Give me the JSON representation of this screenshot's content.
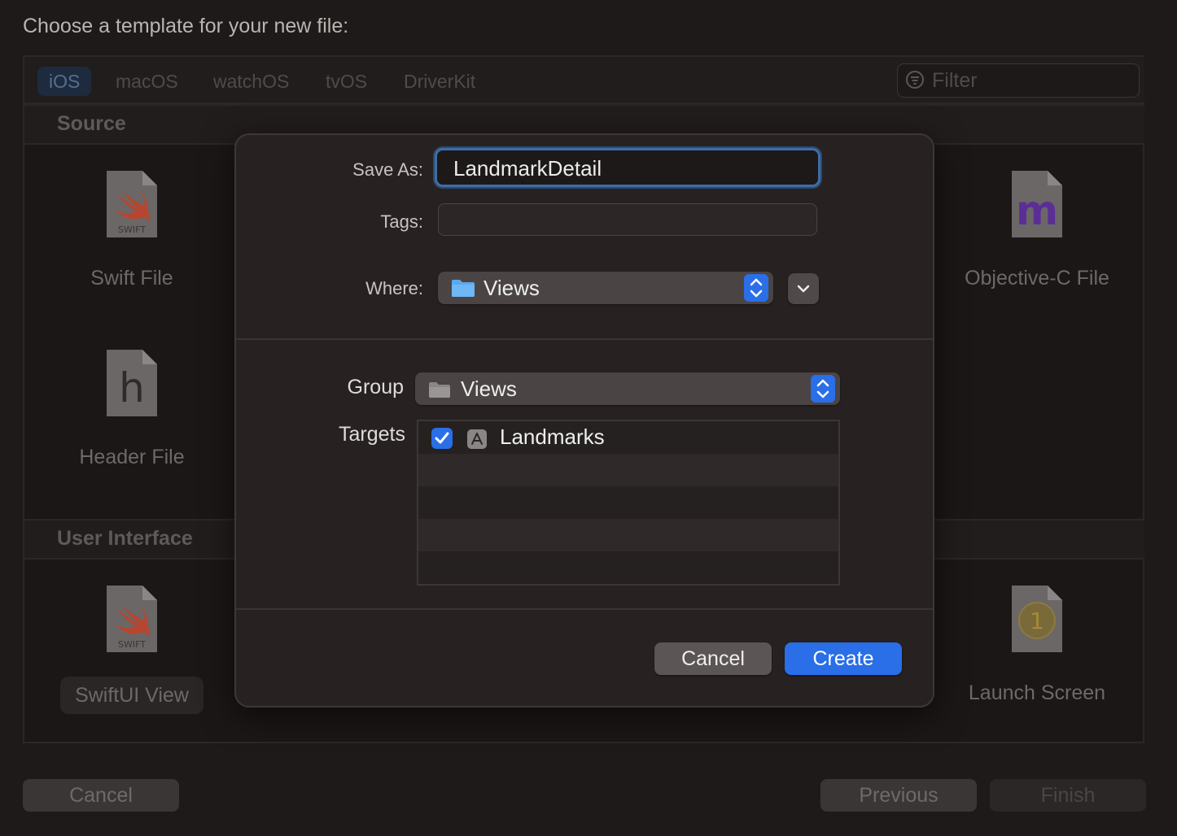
{
  "window": {
    "prompt": "Choose a template for your new file:"
  },
  "platform_tabs": [
    {
      "label": "iOS",
      "selected": true
    },
    {
      "label": "macOS",
      "selected": false
    },
    {
      "label": "watchOS",
      "selected": false
    },
    {
      "label": "tvOS",
      "selected": false
    },
    {
      "label": "DriverKit",
      "selected": false
    }
  ],
  "filter": {
    "placeholder": "Filter"
  },
  "sections": {
    "source": {
      "title": "Source",
      "templates": [
        {
          "label": "Swift File",
          "icon": "swift-file-icon",
          "badge": "SWIFT"
        },
        {
          "label": "Objective-C File",
          "icon": "objc-file-icon",
          "glyph": "m"
        },
        {
          "label": "Header File",
          "icon": "header-file-icon",
          "glyph": "h"
        }
      ]
    },
    "user_interface": {
      "title": "User Interface",
      "templates": [
        {
          "label": "SwiftUI View",
          "icon": "swift-file-icon",
          "badge": "SWIFT",
          "selected": true
        },
        {
          "label": "Launch Screen",
          "icon": "launch-screen-icon",
          "glyph": "1"
        }
      ]
    }
  },
  "dialog": {
    "save_as": {
      "label": "Save As:",
      "value": "LandmarkDetail"
    },
    "tags": {
      "label": "Tags:",
      "value": ""
    },
    "where": {
      "label": "Where:",
      "value": "Views"
    },
    "group": {
      "label": "Group",
      "value": "Views"
    },
    "targets": {
      "label": "Targets",
      "items": [
        {
          "name": "Landmarks",
          "checked": true
        }
      ]
    },
    "cancel_label": "Cancel",
    "create_label": "Create"
  },
  "footer": {
    "cancel_label": "Cancel",
    "previous_label": "Previous",
    "finish_label": "Finish"
  },
  "colors": {
    "accent": "#2a6ee8",
    "background": "#1e1a19",
    "dialog_bg": "#272221",
    "objc_glyph": "#7b3fc8"
  }
}
